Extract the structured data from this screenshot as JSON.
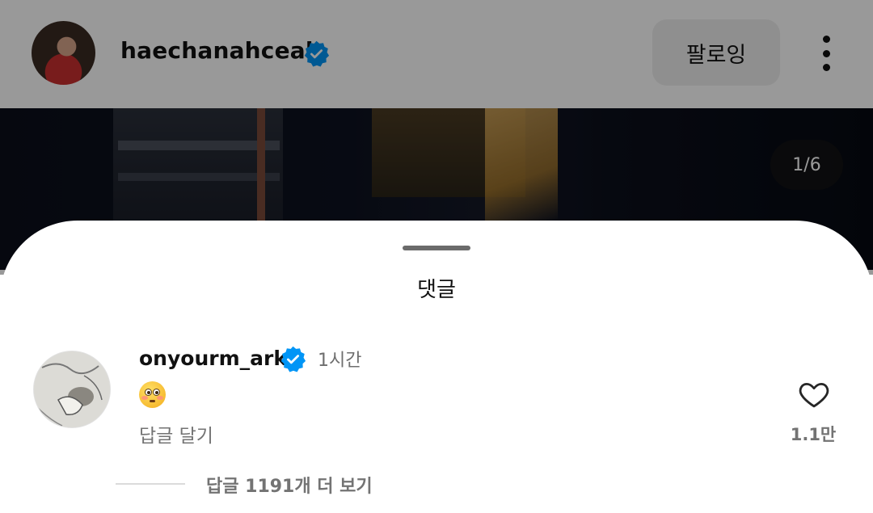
{
  "post_header": {
    "username": "haechanahceah",
    "follow_label": "팔로잉"
  },
  "post_image": {
    "counter": "1/6"
  },
  "comments_sheet": {
    "title": "댓글",
    "comment": {
      "username": "onyourm_ark",
      "time": "1시간",
      "text_emoji": "flushed-face-emoji",
      "reply_label": "답글 달기",
      "like_count": "1.1만",
      "view_replies_label": "답글 1191개 더 보기"
    }
  },
  "colors": {
    "verified": "#0095f6",
    "secondary_text": "#737373",
    "button_bg": "#efefef"
  }
}
